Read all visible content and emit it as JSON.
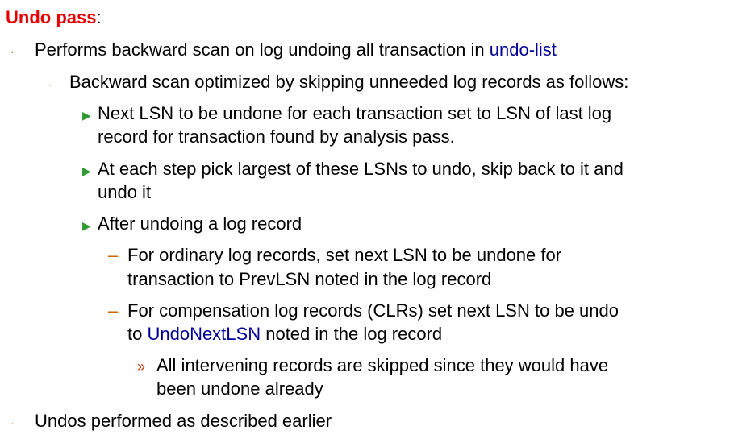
{
  "title": {
    "label": "Undo pass",
    "colon": ":"
  },
  "colors": {
    "title": "#e60000",
    "link": "#000099",
    "bullet_level1": "#cc6600",
    "bullet_level3": "#339933",
    "bullet_level5": "#cc3300"
  },
  "bullets": [
    {
      "marker": "·",
      "text_before": "Performs backward scan on log undoing all transaction in ",
      "link": "undo-list"
    },
    {
      "marker": "·",
      "text": "Backward scan optimized by skipping unneeded log records as follows:"
    },
    {
      "marker": "▶",
      "lines": [
        "Next LSN to be undone for each transaction set to LSN of last log",
        "record for transaction found by analysis pass."
      ]
    },
    {
      "marker": "▶",
      "lines": [
        "At each step pick largest of these LSNs to undo, skip back to it and",
        "undo it"
      ]
    },
    {
      "marker": "▶",
      "lines": [
        "After undoing a log record"
      ]
    },
    {
      "marker": "–",
      "lines": [
        "For ordinary log records, set next LSN to be undone for",
        "transaction to PrevLSN noted in the log record"
      ]
    },
    {
      "marker": "–",
      "line1": "For compensation log records (CLRs) set next LSN to be undo",
      "line2_before": "to ",
      "line2_link": "UndoNextLSN",
      "line2_after": " noted in the log record"
    },
    {
      "marker": "»",
      "lines": [
        "All intervening records are skipped since they would have",
        "been undone already"
      ]
    },
    {
      "marker": "·",
      "text": "Undos performed as described earlier"
    }
  ]
}
